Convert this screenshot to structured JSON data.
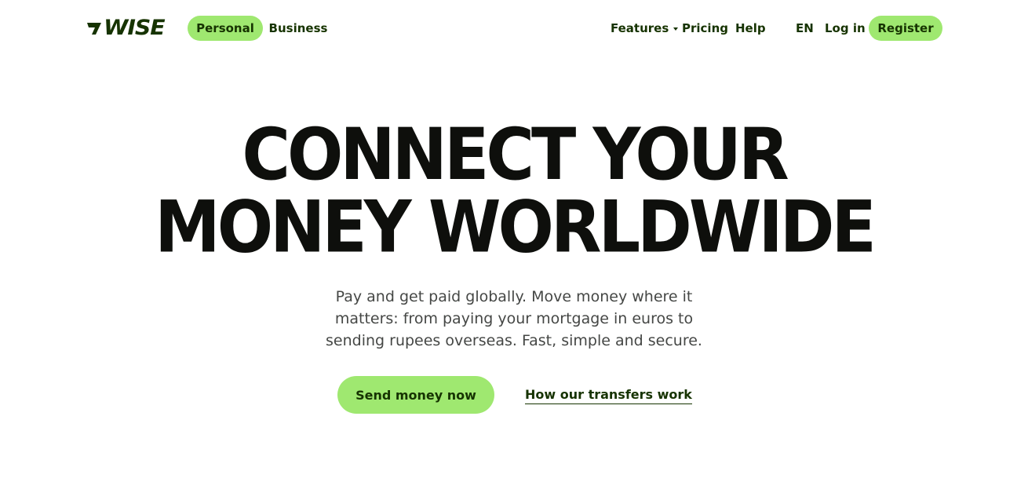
{
  "header": {
    "logo_text": "WISE",
    "nav_left": {
      "personal": "Personal",
      "business": "Business"
    },
    "nav_right": {
      "features": "Features",
      "pricing": "Pricing",
      "help": "Help",
      "language": "EN",
      "login": "Log in",
      "register": "Register"
    }
  },
  "hero": {
    "title_lines": [
      "CONNECT YOUR",
      "MONEY WORLDWIDE"
    ],
    "subtitle_lines": [
      "Pay and get paid globally. Move money where it",
      "matters: from paying your mortgage in euros to",
      "sending rupees overseas. Fast, simple and secure."
    ],
    "primary_cta": "Send money now",
    "secondary_cta": "How our transfers work"
  },
  "colors": {
    "accent": "#9fe870",
    "brand_dark": "#163300",
    "headline": "#0e0f0c",
    "body_text": "#454745"
  }
}
